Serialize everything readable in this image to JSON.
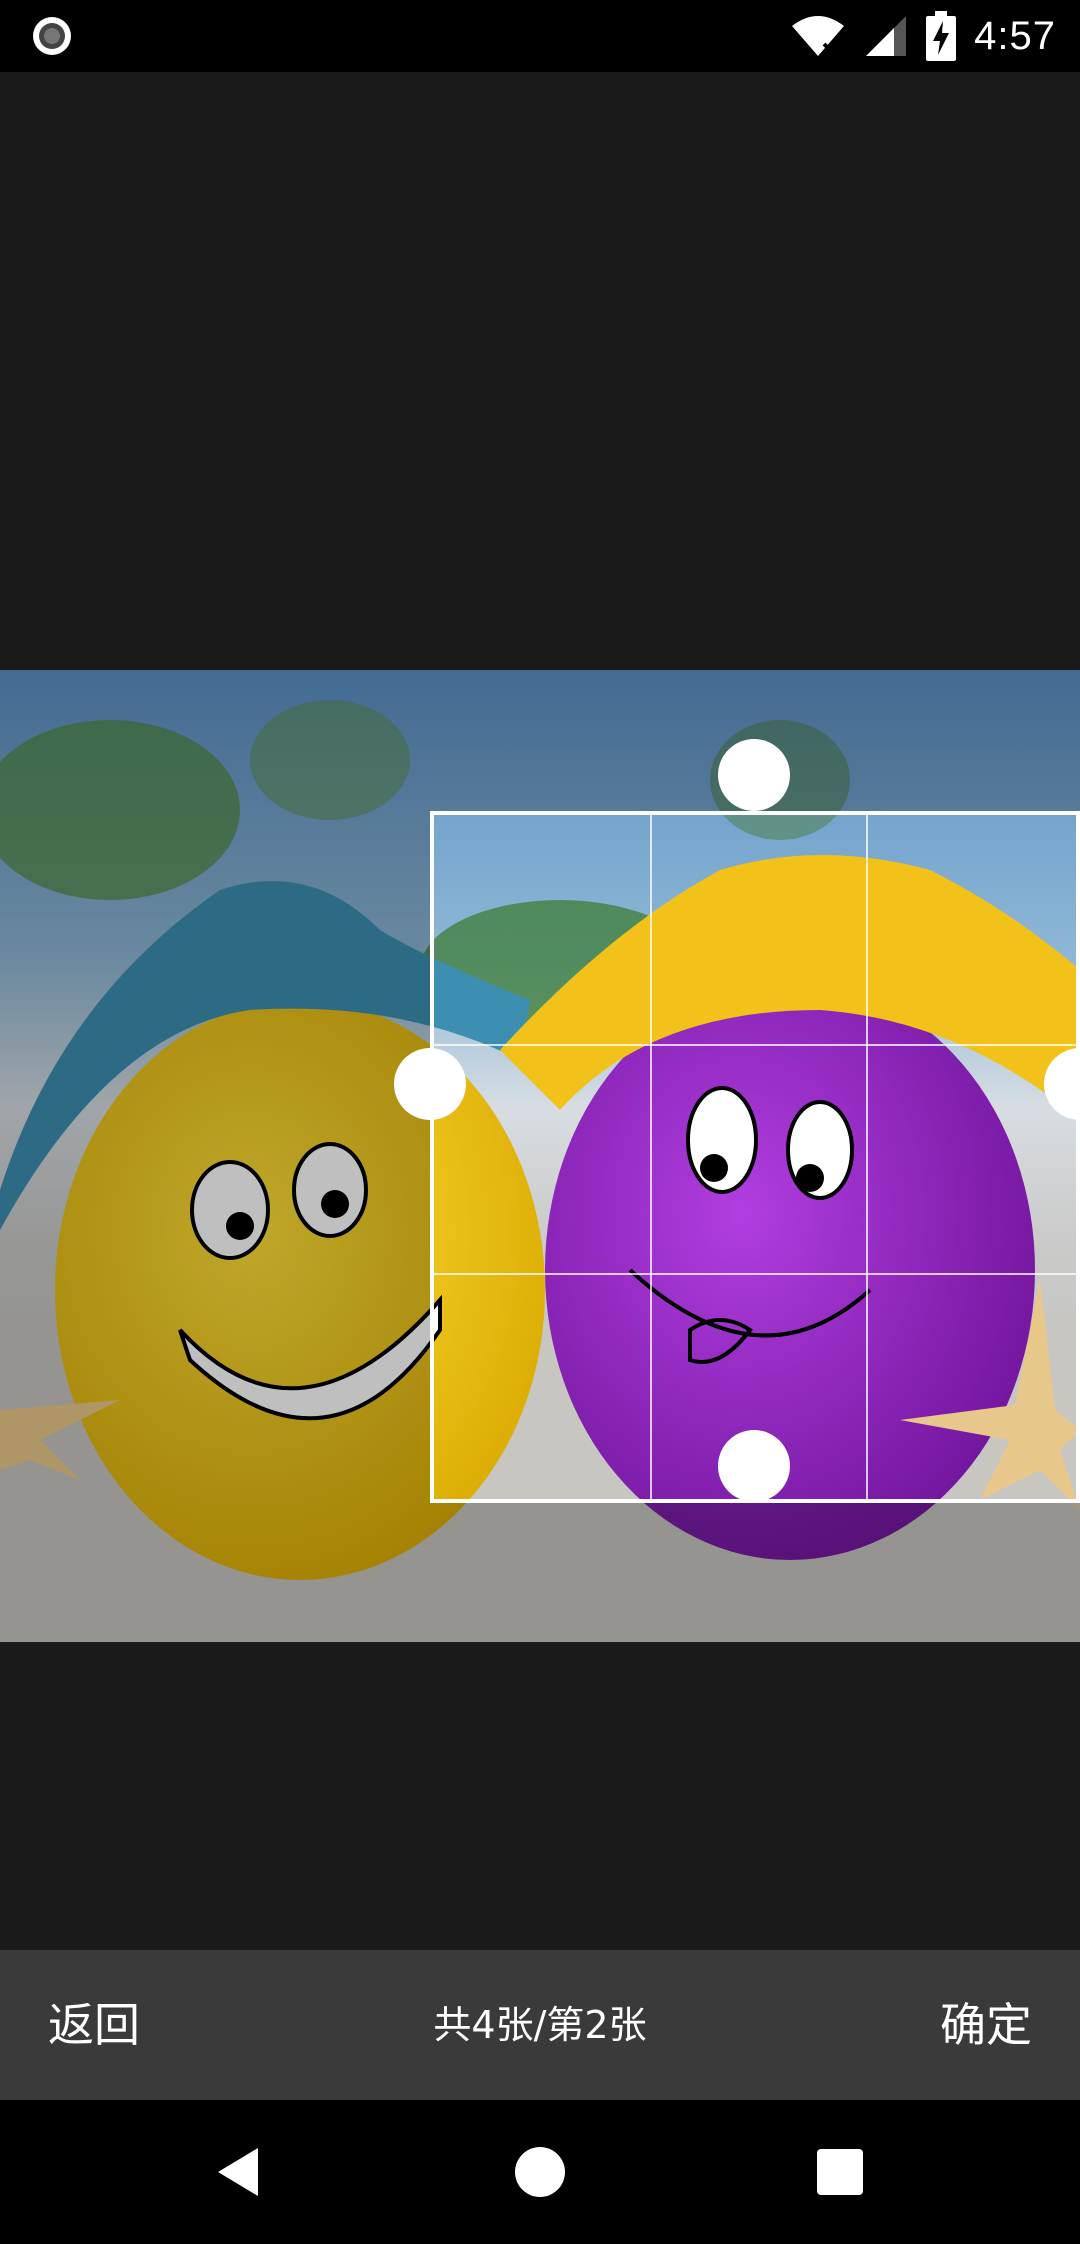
{
  "status_bar": {
    "time": "4:57",
    "icons": [
      "record-icon",
      "wifi-icon",
      "signal-icon",
      "battery-charging-icon"
    ]
  },
  "image_editor": {
    "mode": "crop",
    "grid": "3x3"
  },
  "action_bar": {
    "back_label": "返回",
    "counter_text": "共4张/第2张",
    "confirm_label": "确定"
  },
  "nav_bar": {
    "icons": [
      "back-triangle-icon",
      "home-circle-icon",
      "recents-square-icon"
    ]
  },
  "colors": {
    "background": "#1a1a1a",
    "action_bar": "#3a3a3a",
    "status_bar": "#000000",
    "crop_frame": "#ffffff"
  }
}
